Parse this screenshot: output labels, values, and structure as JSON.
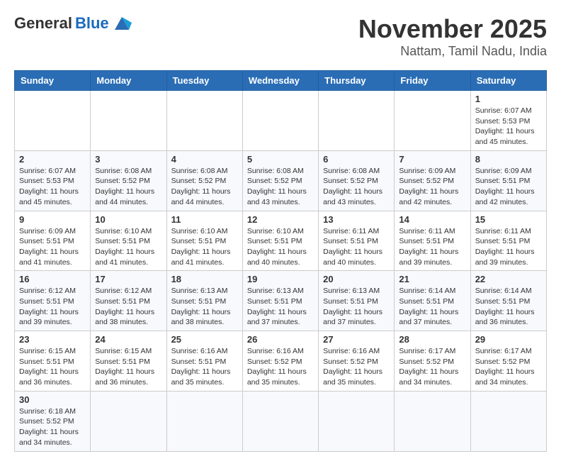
{
  "header": {
    "logo_general": "General",
    "logo_blue": "Blue",
    "month_title": "November 2025",
    "location": "Nattam, Tamil Nadu, India"
  },
  "weekdays": [
    "Sunday",
    "Monday",
    "Tuesday",
    "Wednesday",
    "Thursday",
    "Friday",
    "Saturday"
  ],
  "weeks": [
    [
      {
        "day": "",
        "info": ""
      },
      {
        "day": "",
        "info": ""
      },
      {
        "day": "",
        "info": ""
      },
      {
        "day": "",
        "info": ""
      },
      {
        "day": "",
        "info": ""
      },
      {
        "day": "",
        "info": ""
      },
      {
        "day": "1",
        "info": "Sunrise: 6:07 AM\nSunset: 5:53 PM\nDaylight: 11 hours and 45 minutes."
      }
    ],
    [
      {
        "day": "2",
        "info": "Sunrise: 6:07 AM\nSunset: 5:53 PM\nDaylight: 11 hours and 45 minutes."
      },
      {
        "day": "3",
        "info": "Sunrise: 6:08 AM\nSunset: 5:52 PM\nDaylight: 11 hours and 44 minutes."
      },
      {
        "day": "4",
        "info": "Sunrise: 6:08 AM\nSunset: 5:52 PM\nDaylight: 11 hours and 44 minutes."
      },
      {
        "day": "5",
        "info": "Sunrise: 6:08 AM\nSunset: 5:52 PM\nDaylight: 11 hours and 43 minutes."
      },
      {
        "day": "6",
        "info": "Sunrise: 6:08 AM\nSunset: 5:52 PM\nDaylight: 11 hours and 43 minutes."
      },
      {
        "day": "7",
        "info": "Sunrise: 6:09 AM\nSunset: 5:52 PM\nDaylight: 11 hours and 42 minutes."
      },
      {
        "day": "8",
        "info": "Sunrise: 6:09 AM\nSunset: 5:51 PM\nDaylight: 11 hours and 42 minutes."
      }
    ],
    [
      {
        "day": "9",
        "info": "Sunrise: 6:09 AM\nSunset: 5:51 PM\nDaylight: 11 hours and 41 minutes."
      },
      {
        "day": "10",
        "info": "Sunrise: 6:10 AM\nSunset: 5:51 PM\nDaylight: 11 hours and 41 minutes."
      },
      {
        "day": "11",
        "info": "Sunrise: 6:10 AM\nSunset: 5:51 PM\nDaylight: 11 hours and 41 minutes."
      },
      {
        "day": "12",
        "info": "Sunrise: 6:10 AM\nSunset: 5:51 PM\nDaylight: 11 hours and 40 minutes."
      },
      {
        "day": "13",
        "info": "Sunrise: 6:11 AM\nSunset: 5:51 PM\nDaylight: 11 hours and 40 minutes."
      },
      {
        "day": "14",
        "info": "Sunrise: 6:11 AM\nSunset: 5:51 PM\nDaylight: 11 hours and 39 minutes."
      },
      {
        "day": "15",
        "info": "Sunrise: 6:11 AM\nSunset: 5:51 PM\nDaylight: 11 hours and 39 minutes."
      }
    ],
    [
      {
        "day": "16",
        "info": "Sunrise: 6:12 AM\nSunset: 5:51 PM\nDaylight: 11 hours and 39 minutes."
      },
      {
        "day": "17",
        "info": "Sunrise: 6:12 AM\nSunset: 5:51 PM\nDaylight: 11 hours and 38 minutes."
      },
      {
        "day": "18",
        "info": "Sunrise: 6:13 AM\nSunset: 5:51 PM\nDaylight: 11 hours and 38 minutes."
      },
      {
        "day": "19",
        "info": "Sunrise: 6:13 AM\nSunset: 5:51 PM\nDaylight: 11 hours and 37 minutes."
      },
      {
        "day": "20",
        "info": "Sunrise: 6:13 AM\nSunset: 5:51 PM\nDaylight: 11 hours and 37 minutes."
      },
      {
        "day": "21",
        "info": "Sunrise: 6:14 AM\nSunset: 5:51 PM\nDaylight: 11 hours and 37 minutes."
      },
      {
        "day": "22",
        "info": "Sunrise: 6:14 AM\nSunset: 5:51 PM\nDaylight: 11 hours and 36 minutes."
      }
    ],
    [
      {
        "day": "23",
        "info": "Sunrise: 6:15 AM\nSunset: 5:51 PM\nDaylight: 11 hours and 36 minutes."
      },
      {
        "day": "24",
        "info": "Sunrise: 6:15 AM\nSunset: 5:51 PM\nDaylight: 11 hours and 36 minutes."
      },
      {
        "day": "25",
        "info": "Sunrise: 6:16 AM\nSunset: 5:51 PM\nDaylight: 11 hours and 35 minutes."
      },
      {
        "day": "26",
        "info": "Sunrise: 6:16 AM\nSunset: 5:52 PM\nDaylight: 11 hours and 35 minutes."
      },
      {
        "day": "27",
        "info": "Sunrise: 6:16 AM\nSunset: 5:52 PM\nDaylight: 11 hours and 35 minutes."
      },
      {
        "day": "28",
        "info": "Sunrise: 6:17 AM\nSunset: 5:52 PM\nDaylight: 11 hours and 34 minutes."
      },
      {
        "day": "29",
        "info": "Sunrise: 6:17 AM\nSunset: 5:52 PM\nDaylight: 11 hours and 34 minutes."
      }
    ],
    [
      {
        "day": "30",
        "info": "Sunrise: 6:18 AM\nSunset: 5:52 PM\nDaylight: 11 hours and 34 minutes."
      },
      {
        "day": "",
        "info": ""
      },
      {
        "day": "",
        "info": ""
      },
      {
        "day": "",
        "info": ""
      },
      {
        "day": "",
        "info": ""
      },
      {
        "day": "",
        "info": ""
      },
      {
        "day": "",
        "info": ""
      }
    ]
  ]
}
